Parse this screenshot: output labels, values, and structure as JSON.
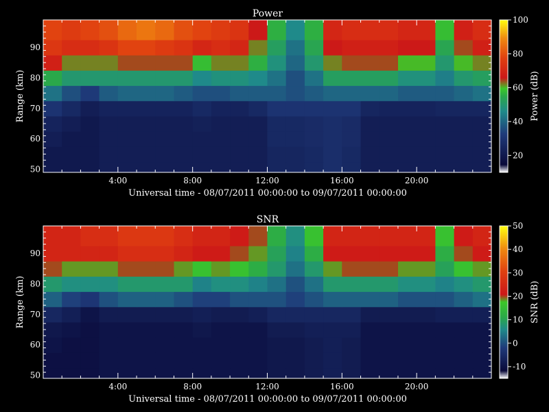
{
  "chart_data": [
    {
      "type": "heatmap",
      "title": "Power",
      "xlabel": "Universal time - 08/07/2011 00:00:00 to 09/07/2011 00:00:00",
      "ylabel": "Range (km)",
      "colorbar_label": "Power (dB)",
      "x_ticks": [
        "4:00",
        "8:00",
        "12:00",
        "16:00",
        "20:00"
      ],
      "x_tick_hours": [
        4,
        8,
        12,
        16,
        20
      ],
      "xlim_hours": [
        0,
        24
      ],
      "y_ticks": [
        50,
        60,
        70,
        80,
        90
      ],
      "ylim": [
        49,
        99
      ],
      "colorbar_ticks": [
        20,
        40,
        60,
        80,
        100
      ],
      "colorbar_range": [
        10,
        100
      ],
      "cells": {
        "x_hours": [
          0,
          1,
          2,
          3,
          4,
          5,
          6,
          7,
          8,
          9,
          10,
          11,
          12,
          13,
          14,
          15,
          16,
          17,
          18,
          19,
          20,
          21,
          22,
          23
        ],
        "range_km": [
          50,
          55,
          60,
          65,
          70,
          75,
          80,
          85,
          90,
          95
        ],
        "values": [
          [
            20,
            20,
            20,
            22,
            22,
            22,
            22,
            22,
            22,
            22,
            22,
            22,
            25,
            25,
            26,
            28,
            26,
            22,
            22,
            22,
            22,
            22,
            22,
            22
          ],
          [
            20,
            20,
            20,
            22,
            22,
            22,
            22,
            22,
            22,
            22,
            22,
            22,
            25,
            25,
            26,
            28,
            26,
            22,
            22,
            22,
            22,
            22,
            22,
            22
          ],
          [
            22,
            20,
            20,
            22,
            22,
            22,
            22,
            22,
            22,
            22,
            22,
            22,
            26,
            26,
            27,
            28,
            27,
            22,
            22,
            22,
            22,
            22,
            22,
            22
          ],
          [
            24,
            22,
            20,
            22,
            22,
            22,
            22,
            22,
            23,
            22,
            22,
            22,
            26,
            26,
            27,
            28,
            27,
            22,
            22,
            22,
            22,
            22,
            22,
            22
          ],
          [
            30,
            26,
            22,
            24,
            24,
            24,
            24,
            24,
            26,
            24,
            24,
            26,
            30,
            30,
            30,
            30,
            30,
            25,
            24,
            24,
            24,
            25,
            25,
            25
          ],
          [
            42,
            36,
            32,
            38,
            40,
            40,
            40,
            38,
            36,
            36,
            38,
            38,
            38,
            36,
            38,
            40,
            40,
            40,
            40,
            38,
            38,
            38,
            40,
            42
          ],
          [
            55,
            50,
            50,
            50,
            50,
            50,
            50,
            50,
            46,
            48,
            48,
            46,
            42,
            36,
            42,
            52,
            52,
            52,
            52,
            48,
            48,
            44,
            50,
            52
          ],
          [
            68,
            62,
            62,
            62,
            64,
            64,
            64,
            64,
            58,
            62,
            62,
            56,
            48,
            40,
            50,
            62,
            64,
            64,
            64,
            60,
            60,
            50,
            60,
            62
          ],
          [
            75,
            72,
            72,
            74,
            78,
            78,
            76,
            74,
            70,
            72,
            70,
            62,
            52,
            42,
            54,
            66,
            68,
            68,
            68,
            66,
            66,
            54,
            64,
            68
          ],
          [
            78,
            76,
            78,
            80,
            84,
            86,
            84,
            80,
            78,
            76,
            74,
            66,
            56,
            46,
            56,
            70,
            72,
            72,
            72,
            70,
            70,
            58,
            68,
            72
          ]
        ]
      }
    },
    {
      "type": "heatmap",
      "title": "SNR",
      "xlabel": "Universal time - 08/07/2011 00:00:00 to 09/07/2011 00:00:00",
      "ylabel": "Range (km)",
      "colorbar_label": "SNR (dB)",
      "x_ticks": [
        "4:00",
        "8:00",
        "12:00",
        "16:00",
        "20:00"
      ],
      "x_tick_hours": [
        4,
        8,
        12,
        16,
        20
      ],
      "xlim_hours": [
        0,
        24
      ],
      "y_ticks": [
        50,
        60,
        70,
        80,
        90
      ],
      "ylim": [
        49,
        99
      ],
      "colorbar_ticks": [
        -10,
        0,
        10,
        20,
        30,
        40,
        50
      ],
      "colorbar_range": [
        -15,
        50
      ],
      "cells": {
        "x_hours": [
          0,
          1,
          2,
          3,
          4,
          5,
          6,
          7,
          8,
          9,
          10,
          11,
          12,
          13,
          14,
          15,
          16,
          17,
          18,
          19,
          20,
          21,
          22,
          23
        ],
        "range_km": [
          50,
          55,
          60,
          65,
          70,
          75,
          80,
          85,
          90,
          95
        ],
        "values": [
          [
            -10,
            -10,
            -10,
            -9,
            -9,
            -9,
            -9,
            -9,
            -9,
            -9,
            -9,
            -9,
            -8,
            -8,
            -7,
            -6,
            -7,
            -9,
            -9,
            -9,
            -9,
            -9,
            -9,
            -9
          ],
          [
            -10,
            -10,
            -10,
            -9,
            -9,
            -9,
            -9,
            -9,
            -9,
            -9,
            -9,
            -9,
            -8,
            -8,
            -7,
            -6,
            -7,
            -9,
            -9,
            -9,
            -9,
            -9,
            -9,
            -9
          ],
          [
            -9,
            -10,
            -10,
            -9,
            -9,
            -9,
            -9,
            -9,
            -9,
            -9,
            -9,
            -9,
            -8,
            -8,
            -7,
            -6,
            -7,
            -9,
            -9,
            -9,
            -9,
            -9,
            -9,
            -9
          ],
          [
            -8,
            -9,
            -10,
            -9,
            -9,
            -9,
            -9,
            -9,
            -8,
            -9,
            -9,
            -9,
            -7,
            -7,
            -6,
            -6,
            -6,
            -9,
            -9,
            -9,
            -9,
            -9,
            -9,
            -9
          ],
          [
            -4,
            -6,
            -9,
            -7,
            -7,
            -7,
            -7,
            -7,
            -6,
            -7,
            -7,
            -6,
            -4,
            -4,
            -4,
            -4,
            -4,
            -7,
            -7,
            -7,
            -7,
            -6,
            -6,
            -6
          ],
          [
            6,
            2,
            0,
            4,
            6,
            6,
            6,
            4,
            2,
            2,
            4,
            4,
            4,
            2,
            4,
            6,
            6,
            6,
            6,
            4,
            4,
            4,
            6,
            8
          ],
          [
            14,
            12,
            12,
            12,
            14,
            14,
            14,
            14,
            10,
            12,
            12,
            10,
            8,
            4,
            8,
            14,
            14,
            14,
            14,
            12,
            12,
            10,
            12,
            14
          ],
          [
            24,
            22,
            22,
            22,
            24,
            24,
            24,
            22,
            20,
            22,
            20,
            18,
            14,
            8,
            14,
            22,
            24,
            24,
            24,
            22,
            22,
            16,
            20,
            22
          ],
          [
            28,
            28,
            28,
            28,
            30,
            30,
            30,
            28,
            26,
            26,
            24,
            22,
            16,
            10,
            18,
            26,
            26,
            26,
            26,
            26,
            26,
            18,
            24,
            26
          ],
          [
            28,
            28,
            30,
            30,
            32,
            32,
            32,
            30,
            28,
            28,
            26,
            24,
            18,
            12,
            20,
            28,
            28,
            28,
            28,
            28,
            28,
            20,
            26,
            28
          ]
        ]
      }
    }
  ]
}
